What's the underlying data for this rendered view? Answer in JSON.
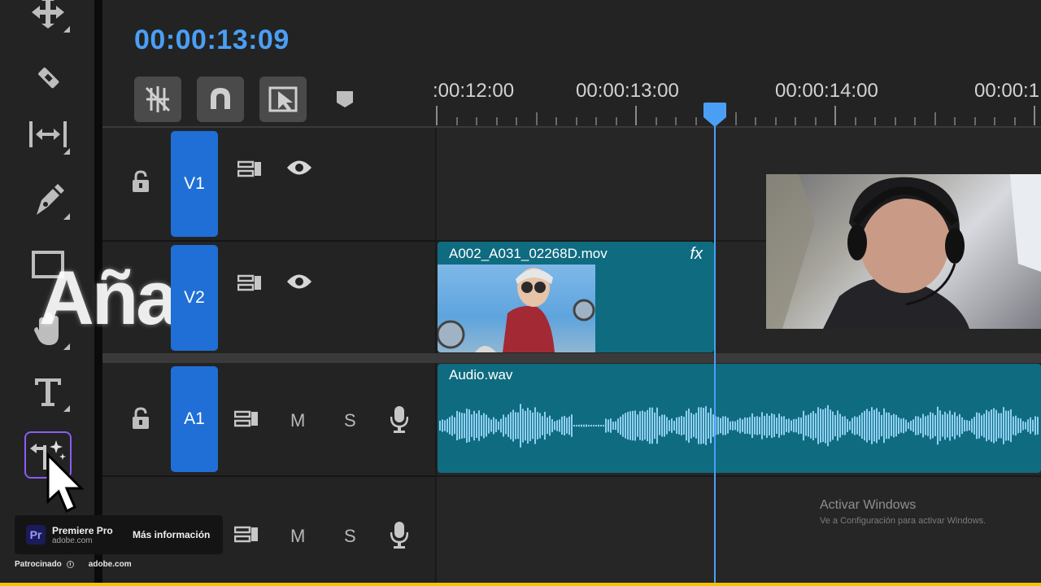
{
  "timeline": {
    "timecode": "00:00:13:09",
    "ruler_labels": [
      ":00:12:00",
      "00:00:13:00",
      "00:00:14:00",
      "00:00:1"
    ]
  },
  "tracks": {
    "v1": {
      "label": "V1"
    },
    "v2": {
      "label": "V2"
    },
    "a1": {
      "label": "A1",
      "mute": "M",
      "solo": "S"
    },
    "a2": {
      "mute": "M",
      "solo": "S"
    }
  },
  "clips": {
    "video_clip_name": "A002_A031_02268D.mov",
    "video_fx": "fx",
    "audio_clip_name": "Audio.wav"
  },
  "overlay_text": "Aña",
  "ad": {
    "logo": "Pr",
    "title": "Premiere Pro",
    "domain": "adobe.com",
    "cta": "Más información",
    "sponsored": "Patrocinado",
    "footer_domain": "adobe.com"
  },
  "watermark": {
    "line1": "Activar Windows",
    "line2": "Ve a Configuración para activar Windows."
  },
  "colors": {
    "accent": "#4a9ff5",
    "track_label": "#1f6fd6",
    "clip": "#0f6b80",
    "waveform": "#8fd0f2",
    "active_tool_border": "#8b5cf6"
  }
}
